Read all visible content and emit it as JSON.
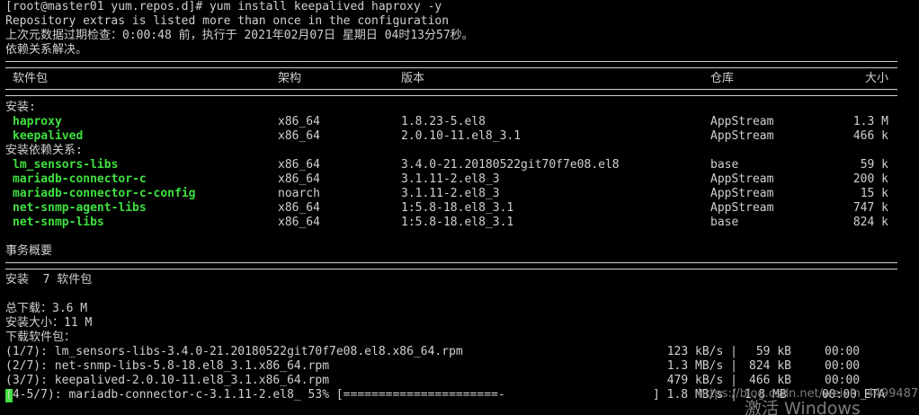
{
  "terminal": {
    "prompt_line": "[root@master01 yum.repos.d]# yum install keepalived haproxy -y",
    "warning_line": "Repository extras is listed more than once in the configuration",
    "metadata_line": "上次元数据过期检查：0:00:48 前，执行于 2021年02月07日 星期日 04时13分57秒。",
    "resolved_line": "依赖关系解决。"
  },
  "table": {
    "headers": {
      "package": "软件包",
      "arch": "架构",
      "version": "版本",
      "repo": "仓库",
      "size": "大小"
    },
    "install_section": "安装:",
    "deps_section": "安装依赖关系:",
    "install": [
      {
        "name": "haproxy",
        "arch": "x86_64",
        "version": "1.8.23-5.el8",
        "repo": "AppStream",
        "size": "1.3 M"
      },
      {
        "name": "keepalived",
        "arch": "x86_64",
        "version": "2.0.10-11.el8_3.1",
        "repo": "AppStream",
        "size": "466 k"
      }
    ],
    "deps": [
      {
        "name": "lm_sensors-libs",
        "arch": "x86_64",
        "version": "3.4.0-21.20180522git70f7e08.el8",
        "repo": "base",
        "size": "59 k"
      },
      {
        "name": "mariadb-connector-c",
        "arch": "x86_64",
        "version": "3.1.11-2.el8_3",
        "repo": "AppStream",
        "size": "200 k"
      },
      {
        "name": "mariadb-connector-c-config",
        "arch": "noarch",
        "version": "3.1.11-2.el8_3",
        "repo": "AppStream",
        "size": "15 k"
      },
      {
        "name": "net-snmp-agent-libs",
        "arch": "x86_64",
        "version": "1:5.8-18.el8_3.1",
        "repo": "AppStream",
        "size": "747 k"
      },
      {
        "name": "net-snmp-libs",
        "arch": "x86_64",
        "version": "1:5.8-18.el8_3.1",
        "repo": "base",
        "size": "824 k"
      }
    ]
  },
  "summary": {
    "title": "事务概要",
    "install_count": "安装  7 软件包",
    "total_download": "总下载：3.6 M",
    "installed_size": "安装大小：11 M",
    "downloading": "下载软件包："
  },
  "downloads": [
    {
      "file": "(1/7): lm_sensors-libs-3.4.0-21.20180522git70f7e08.el8.x86_64.rpm",
      "speed": "123 kB/s |",
      "size": " 59 kB",
      "time": "00:00"
    },
    {
      "file": "(2/7): net-snmp-libs-5.8-18.el8_3.1.x86_64.rpm",
      "speed": "1.3 MB/s |",
      "size": "824 kB",
      "time": "00:00"
    },
    {
      "file": "(3/7): keepalived-2.0.10-11.el8_3.1.x86_64.rpm",
      "speed": "479 kB/s |",
      "size": "466 kB",
      "time": "00:00"
    }
  ],
  "progress_line": {
    "text": "(4-5/7): mariadb-connector-c-3.1.11-2.el8_ 53% [======================-",
    "tail": "] 1.8 MB/s | 1.8 MB     00:00 ETA"
  },
  "watermark": {
    "url": "https://blog.csdn.net/weixin_44994870",
    "activate": "激活 Windows"
  }
}
